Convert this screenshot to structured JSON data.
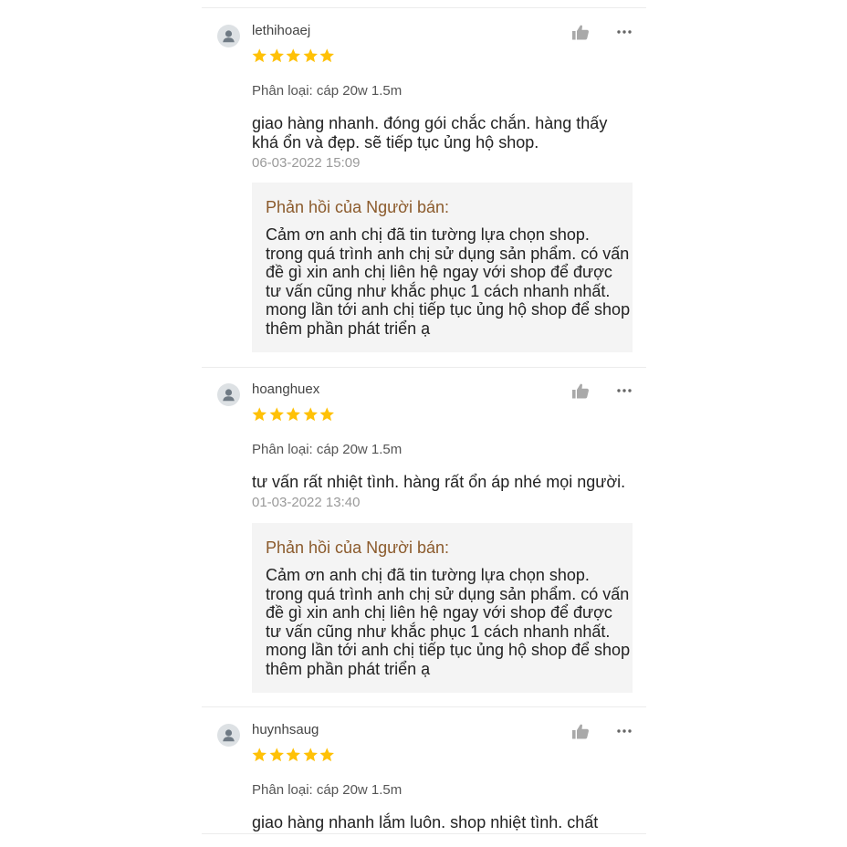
{
  "reviews": [
    {
      "username": "lethihoaej",
      "rating": 5,
      "variant": "Phân loại: cáp 20w 1.5m",
      "comment": "giao hàng nhanh. đóng gói chắc chắn. hàng thấy khá ổn và đẹp. sẽ tiếp tục ủng hộ shop.",
      "date": "06-03-2022 15:09",
      "reply_title": "Phản hồi của Người bán:",
      "reply_text": "Cảm ơn anh chị đã tin tường lựa chọn shop. trong quá trình anh chị sử dụng sản phẩm. có vấn đề gì xin anh chị liên hệ ngay với shop để được tư vấn cũng như khắc phục 1 cách nhanh nhất. mong lần tới anh chị tiếp tục ủng hộ shop để shop thêm phần phát triển ạ"
    },
    {
      "username": "hoanghuex",
      "rating": 5,
      "variant": "Phân loại: cáp 20w 1.5m",
      "comment": "tư vấn rất nhiệt tình. hàng rất ổn áp nhé mọi người.",
      "date": "01-03-2022 13:40",
      "reply_title": "Phản hồi của Người bán:",
      "reply_text": "Cảm ơn anh chị đã tin tường lựa chọn shop. trong quá trình anh chị sử dụng sản phẩm. có vấn đề gì xin anh chị liên hệ ngay với shop để được tư vấn cũng như khắc phục 1 cách nhanh nhất. mong lần tới anh chị tiếp tục ủng hộ shop để shop thêm phần phát triển ạ"
    },
    {
      "username": "huynhsaug",
      "rating": 5,
      "variant": "Phân loại: cáp 20w 1.5m",
      "comment": "giao hàng nhanh lắm luôn. shop nhiệt tình. chất lượng khá ok nữa chớ"
    }
  ],
  "icons": {
    "avatar": "user-silhouette-icon",
    "like": "thumbs-up-icon",
    "more": "ellipsis-icon",
    "star": "star-icon"
  },
  "colors": {
    "star": "#ffc107",
    "reply_title": "#8b5a2b",
    "reply_bg": "#f4f4f4",
    "date": "#9a9a9a"
  }
}
